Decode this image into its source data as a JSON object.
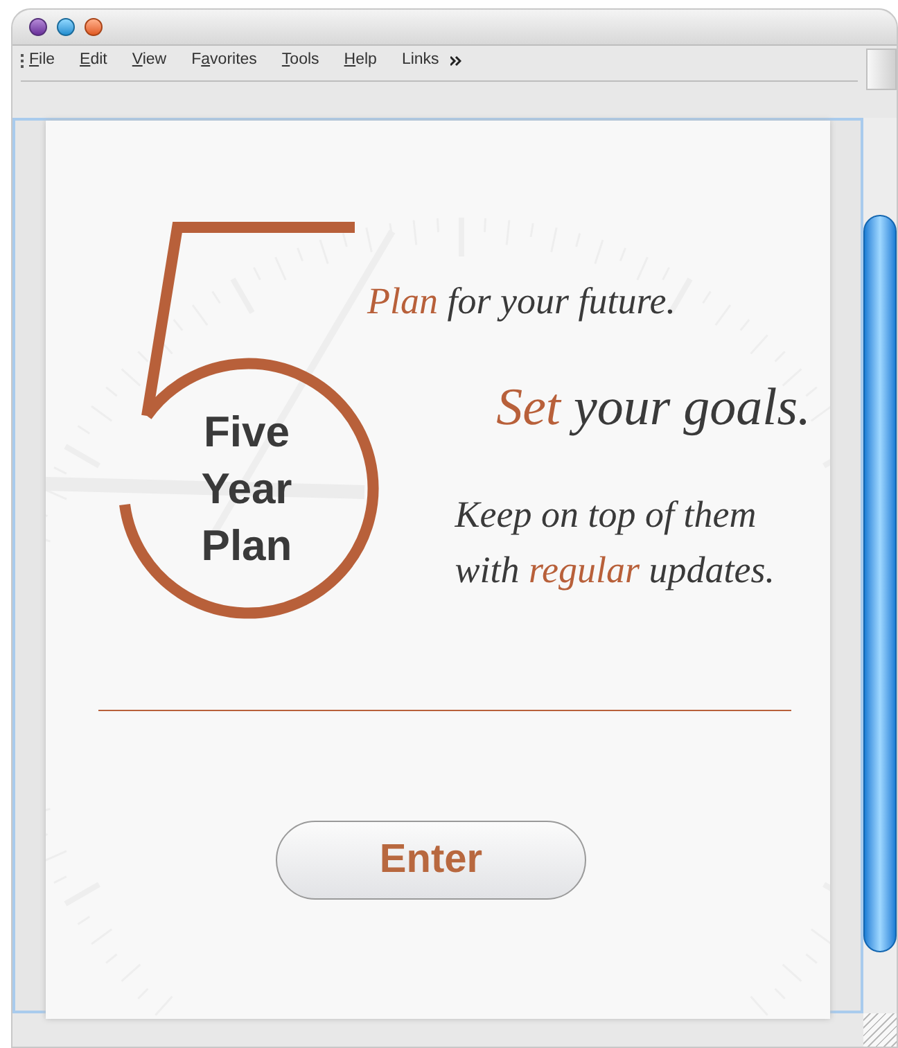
{
  "menu": [
    {
      "key": "F",
      "after": "ile"
    },
    {
      "key": "E",
      "after": "dit"
    },
    {
      "key": "V",
      "after": "iew"
    },
    {
      "before": "F",
      "key": "a",
      "after": "vorites"
    },
    {
      "key": "T",
      "after": "ools"
    },
    {
      "key": "H",
      "after": "elp"
    },
    {
      "before": "Links"
    }
  ],
  "logo": {
    "lines": [
      "Five",
      "Year",
      "Plan"
    ]
  },
  "taglines": [
    {
      "kind": "medium",
      "lines": [
        [
          {
            "text": "Plan",
            "accent": true
          },
          {
            "text": " for your future.",
            "accent": false
          }
        ]
      ]
    },
    {
      "kind": "large",
      "lines": [
        [
          {
            "text": "Set",
            "accent": true
          },
          {
            "text": " your goals.",
            "accent": false
          }
        ]
      ]
    },
    {
      "kind": "medium",
      "lines": [
        [
          {
            "text": "Keep on top of them",
            "accent": false
          }
        ],
        [
          {
            "text": "with ",
            "accent": false
          },
          {
            "text": "regular",
            "accent": true
          },
          {
            "text": " updates.",
            "accent": false
          }
        ]
      ]
    }
  ],
  "button": {
    "label": "Enter"
  }
}
